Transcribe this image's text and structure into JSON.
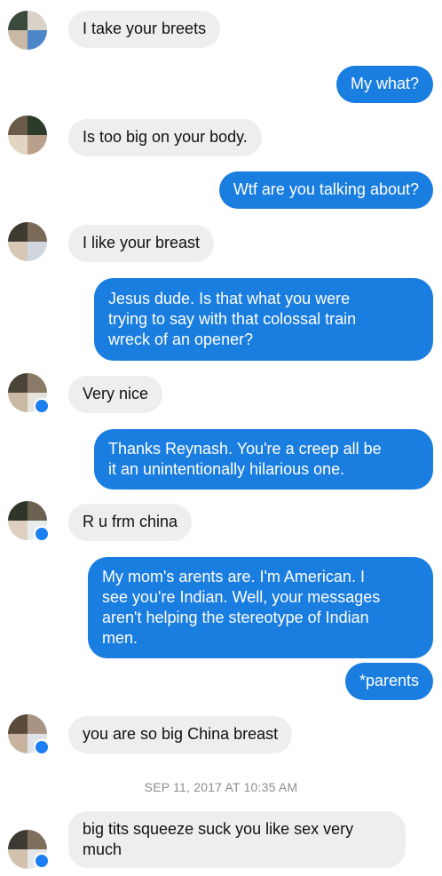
{
  "messages": [
    {
      "side": "in",
      "text": "I take your breets"
    },
    {
      "side": "out",
      "text": "My what?"
    },
    {
      "side": "in",
      "text": "Is too big on your body."
    },
    {
      "side": "out",
      "text": "Wtf are you talking about?"
    },
    {
      "side": "in",
      "text": "I like your breast"
    },
    {
      "side": "out",
      "text": "Jesus dude. Is that what you were\ntrying to say with that colossal train\nwreck of an opener?"
    },
    {
      "side": "in",
      "text": "Very nice"
    },
    {
      "side": "out",
      "text": "Thanks Reynash. You're a creep all be\nit an unintentionally hilarious one."
    },
    {
      "side": "in",
      "text": "R u frm china"
    },
    {
      "side": "out",
      "text": "My mom's arents are. I'm American. I\nsee you're Indian. Well, your messages\naren't helping the stereotype of Indian\nmen."
    },
    {
      "side": "out",
      "text": "*parents"
    },
    {
      "side": "in",
      "text": "you are so big China breast"
    },
    {
      "side": "in",
      "text": "big tits squeeze suck you like sex very\nmuch"
    }
  ],
  "timestamp": "SEP 11, 2017 AT 10:35 AM",
  "colors": {
    "outgoing_bubble": "#1a7de0",
    "incoming_bubble": "#eeeef0",
    "timestamp_text": "#8e8e93",
    "badge": "#1b7ff2"
  },
  "icons": [
    "avatar-pixelated",
    "messenger-badge-icon"
  ]
}
